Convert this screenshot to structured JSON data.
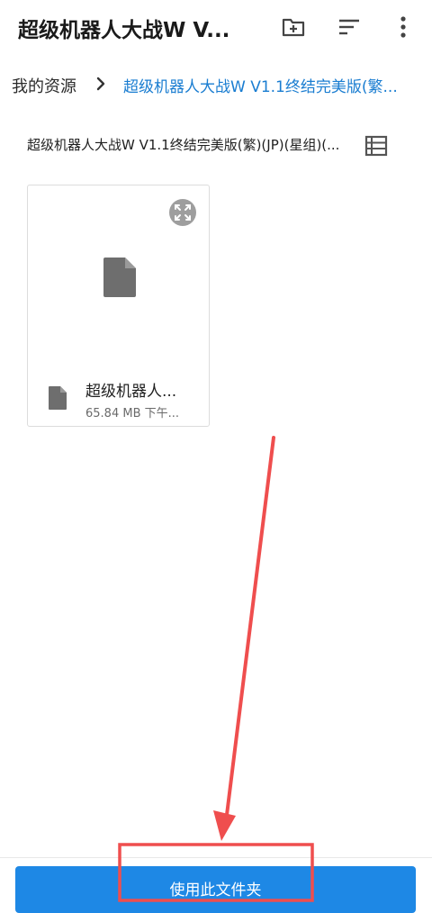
{
  "appbar": {
    "title": "超级机器人大战W V...",
    "icons": [
      "new-folder-icon",
      "sort-icon",
      "more-vert-icon"
    ]
  },
  "breadcrumb": {
    "root": "我的资源",
    "current": "超级机器人大战W V1.1终结完美版(繁..."
  },
  "folder": {
    "name": "超级机器人大战W V1.1终结完美版(繁)(JP)(星组)(..."
  },
  "files": [
    {
      "name": "超级机器人...",
      "meta": "65.84 MB 下午...",
      "icon": "file-icon"
    }
  ],
  "bottom": {
    "button_label": "使用此文件夹"
  },
  "colors": {
    "accent": "#1e88e5",
    "breadcrumb_link": "#1a7dd1",
    "annotation": "#ef4e4e"
  }
}
